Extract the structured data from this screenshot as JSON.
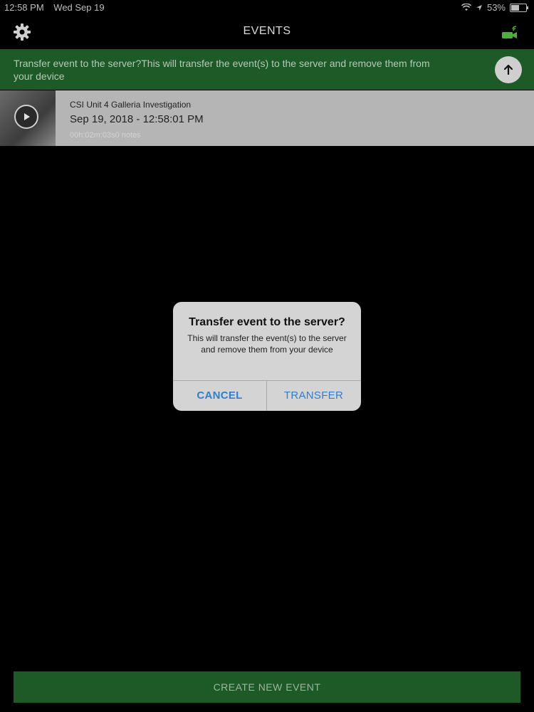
{
  "status_bar": {
    "time": "12:58 PM",
    "date": "Wed Sep 19",
    "battery": "53%",
    "battery_level": 0.53
  },
  "nav": {
    "title": "EVENTS",
    "settings_icon": "gear-icon",
    "camera_status_icon": "camera-connected-icon"
  },
  "banner": {
    "text": "Transfer event to the server?This will transfer the event(s) to the server and remove them from your device",
    "button_icon": "arrow-up-icon"
  },
  "events": [
    {
      "title": "CSI Unit 4 Galleria Investigation",
      "date": "Sep 19, 2018 - 12:58:01 PM",
      "meta": "00h:02m:03s0 notes"
    }
  ],
  "alert": {
    "title": "Transfer event to the server?",
    "message": "This will transfer the event(s) to the server and remove them from your device",
    "cancel_label": "CANCEL",
    "transfer_label": "TRANSFER"
  },
  "footer": {
    "create_label": "CREATE NEW EVENT"
  },
  "colors": {
    "brand_green": "#1e5a28",
    "link_blue": "#2f7fd1"
  }
}
